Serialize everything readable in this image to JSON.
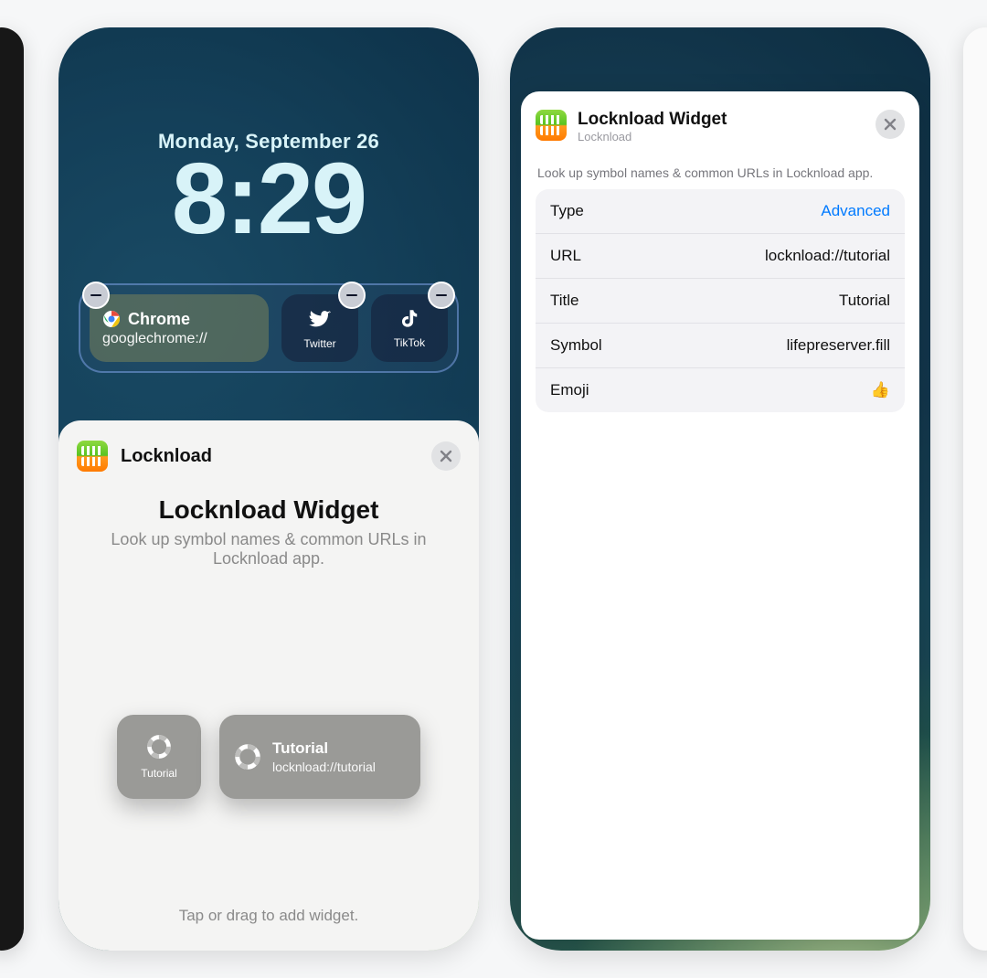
{
  "phone_a": {
    "date": "Monday, September 26",
    "time": "8:29",
    "widgets": {
      "chrome": {
        "title": "Chrome",
        "subtitle": "googlechrome://"
      },
      "twitter": {
        "label": "Twitter"
      },
      "tiktok": {
        "label": "TikTok"
      }
    },
    "sheet": {
      "app_name": "Locknload",
      "title": "Locknload Widget",
      "subtitle": "Look up symbol names & common URLs in Locknload app.",
      "sizes": {
        "small": {
          "label": "Tutorial"
        },
        "wide": {
          "title": "Tutorial",
          "subtitle": "locknload://tutorial"
        }
      },
      "hint": "Tap or drag to add widget."
    }
  },
  "phone_b": {
    "header": {
      "title": "Locknload Widget",
      "subtitle": "Locknload"
    },
    "description": "Look up symbol names & common URLs in Locknload app.",
    "rows": {
      "type": {
        "label": "Type",
        "value": "Advanced"
      },
      "url": {
        "label": "URL",
        "value": "locknload://tutorial"
      },
      "title": {
        "label": "Title",
        "value": "Tutorial"
      },
      "symbol": {
        "label": "Symbol",
        "value": "lifepreserver.fill"
      },
      "emoji": {
        "label": "Emoji",
        "value": "👍"
      }
    }
  }
}
